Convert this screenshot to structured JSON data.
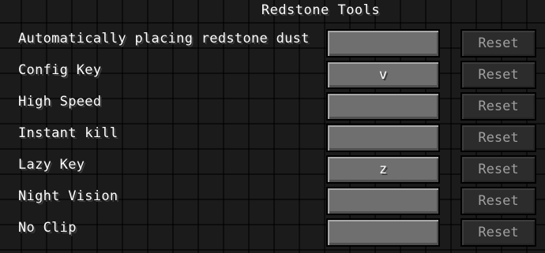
{
  "screen": {
    "title": "Redstone Tools"
  },
  "rows": [
    {
      "label": "Automatically placing redstone dust",
      "key": "",
      "reset": "Reset"
    },
    {
      "label": "Config Key",
      "key": "v",
      "reset": "Reset"
    },
    {
      "label": "High Speed",
      "key": "",
      "reset": "Reset"
    },
    {
      "label": "Instant kill",
      "key": "",
      "reset": "Reset"
    },
    {
      "label": "Lazy Key",
      "key": "z",
      "reset": "Reset"
    },
    {
      "label": "Night Vision",
      "key": "",
      "reset": "Reset"
    },
    {
      "label": "No Clip",
      "key": "",
      "reset": "Reset"
    }
  ]
}
